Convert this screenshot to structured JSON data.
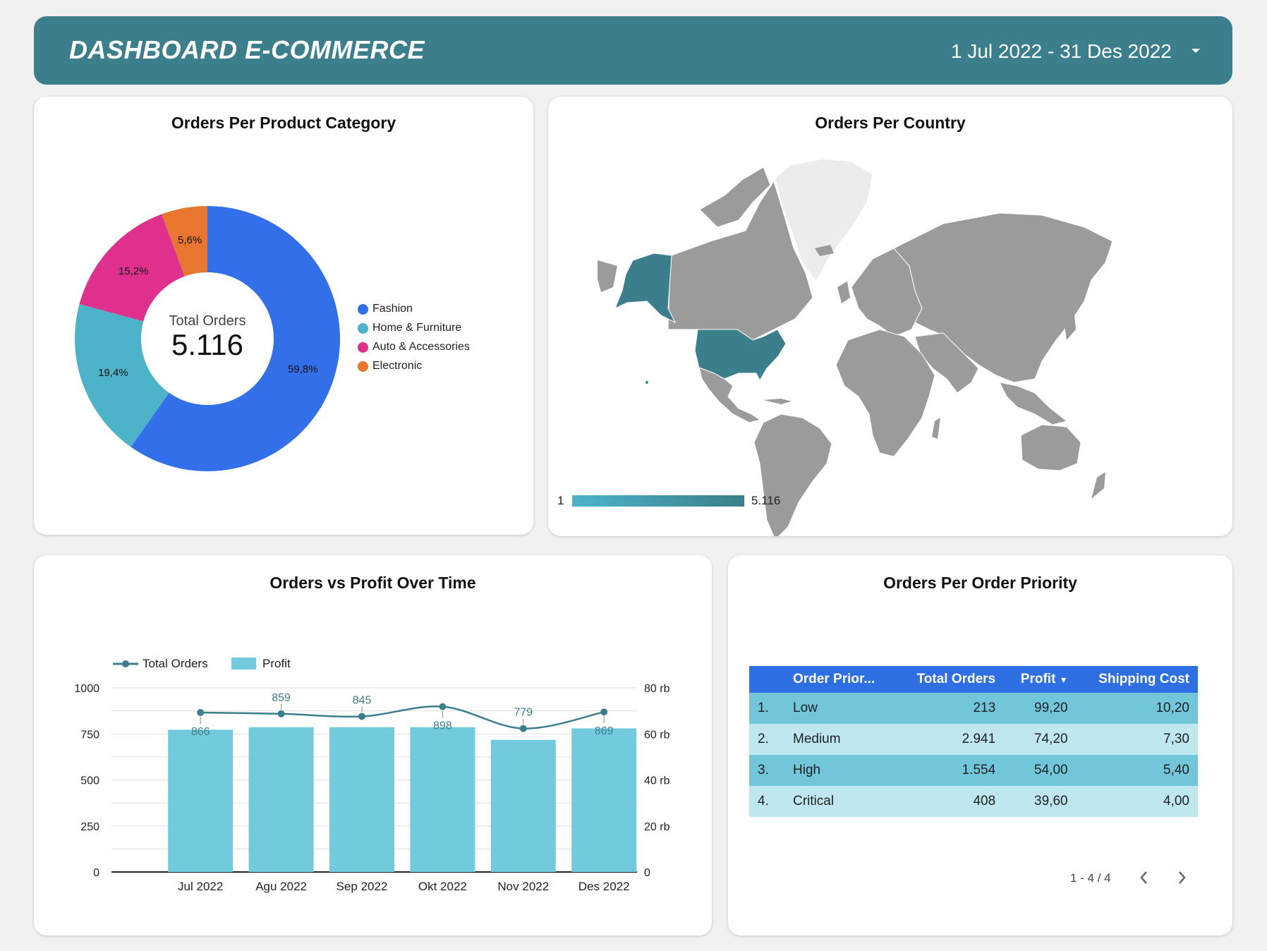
{
  "header": {
    "title": "DASHBOARD E-COMMERCE",
    "date_range": "1 Jul 2022 - 31 Des 2022",
    "dropdown_icon": "caret-down-icon"
  },
  "category_card": {
    "title": "Orders Per Product Category",
    "center_label": "Total Orders",
    "center_value": "5.116",
    "chart_data": {
      "type": "pie",
      "donut": true,
      "title": "Orders Per Product Category",
      "slices": [
        {
          "name": "Fashion",
          "value": 59.8,
          "label": "59,8%",
          "color": "#3170e8"
        },
        {
          "name": "Home & Furniture",
          "value": 19.4,
          "label": "19,4%",
          "color": "#4db3c9"
        },
        {
          "name": "Auto & Accessories",
          "value": 15.2,
          "label": "15,2%",
          "color": "#e0308e"
        },
        {
          "name": "Electronic",
          "value": 5.6,
          "label": "5,6%",
          "color": "#e8762e"
        }
      ],
      "legend_placement": "right"
    }
  },
  "country_card": {
    "title": "Orders Per Country",
    "scale_min": "1",
    "scale_max": "5.116",
    "highlight_color": "#3a7f8b",
    "base_color": "#9b9b9b"
  },
  "time_card": {
    "title": "Orders vs Profit Over Time",
    "legend_orders": "Total Orders",
    "legend_profit": "Profit",
    "chart_data": {
      "type": "bar",
      "categories": [
        "Jul 2022",
        "Agu 2022",
        "Sep 2022",
        "Okt 2022",
        "Nov 2022",
        "Des 2022"
      ],
      "series": [
        {
          "name": "Total Orders",
          "kind": "line",
          "axis": "left",
          "values": [
            866,
            859,
            845,
            898,
            779,
            869
          ],
          "color": "#3a7f8b"
        },
        {
          "name": "Profit",
          "kind": "bar",
          "axis": "right",
          "values": [
            61800,
            62900,
            62900,
            62900,
            57400,
            62400
          ],
          "color": "#72cbdd"
        }
      ],
      "ylim_left": [
        0,
        1000
      ],
      "ylim_right": [
        0,
        80000
      ],
      "left_ticks": [
        "0",
        "250",
        "500",
        "750",
        "1000"
      ],
      "right_ticks": [
        "0",
        "20 rb",
        "40 rb",
        "60 rb",
        "80 rb"
      ],
      "grid": true,
      "legend_placement": "top-left"
    }
  },
  "priority_card": {
    "title": "Orders Per Order Priority",
    "columns": [
      "",
      "Order Prior...",
      "Total Orders",
      "Profit",
      "Shipping Cost"
    ],
    "sort_icon": "sort-desc-icon",
    "rows": [
      [
        "1.",
        "Low",
        "213",
        "99,20",
        "10,20"
      ],
      [
        "2.",
        "Medium",
        "2.941",
        "74,20",
        "7,30"
      ],
      [
        "3.",
        "High",
        "1.554",
        "54,00",
        "5,40"
      ],
      [
        "4.",
        "Critical",
        "408",
        "39,60",
        "4,00"
      ]
    ],
    "pagination": "1 - 4 / 4"
  }
}
